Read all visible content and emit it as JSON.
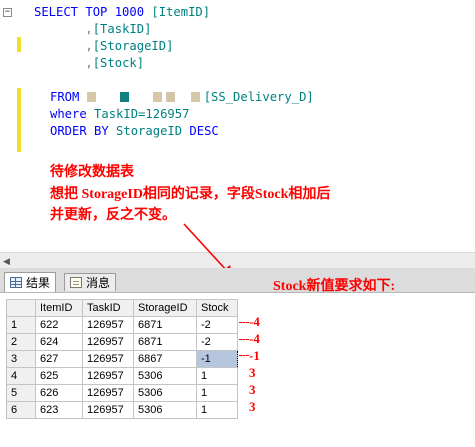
{
  "sql": {
    "l1_select": "SELECT TOP 1000 ",
    "l1_col": "[ItemID]",
    "l2_comma": ",",
    "l2_col": "[TaskID]",
    "l3_comma": ",",
    "l3_col": "[StorageID]",
    "l4_comma": ",",
    "l4_col": "[Stock]",
    "l5_from": "FROM ",
    "l5_table": "[SS_Delivery_D]",
    "l6_where": "where ",
    "l6_cond": "TaskID=126957",
    "l7_order": "ORDER BY ",
    "l7_cond": "StorageID ",
    "l7_desc": "DESC"
  },
  "annotation": {
    "line1": "待修改数据表",
    "line2": "想把 StorageID相同的记录，字段Stock相加后",
    "line3": "并更新，反之不变。",
    "note": "Stock新值要求如下:"
  },
  "tabs": {
    "results": "结果",
    "messages": "消息"
  },
  "grid": {
    "headers": [
      "ItemID",
      "TaskID",
      "StorageID",
      "Stock"
    ],
    "rows": [
      {
        "n": "1",
        "c": [
          "622",
          "126957",
          "6871",
          "-2"
        ]
      },
      {
        "n": "2",
        "c": [
          "624",
          "126957",
          "6871",
          "-2"
        ]
      },
      {
        "n": "3",
        "c": [
          "627",
          "126957",
          "6867",
          "-1"
        ]
      },
      {
        "n": "4",
        "c": [
          "625",
          "126957",
          "5306",
          "1"
        ]
      },
      {
        "n": "5",
        "c": [
          "626",
          "126957",
          "5306",
          "1"
        ]
      },
      {
        "n": "6",
        "c": [
          "623",
          "126957",
          "5306",
          "1"
        ]
      }
    ]
  },
  "new_stock": [
    "-4",
    "-4",
    "-1",
    "3",
    "3",
    "3"
  ],
  "colors": {
    "keyword": "#0000ff",
    "identifier": "#008080",
    "annotation": "#ff0000",
    "selection": "#b7c6df"
  }
}
